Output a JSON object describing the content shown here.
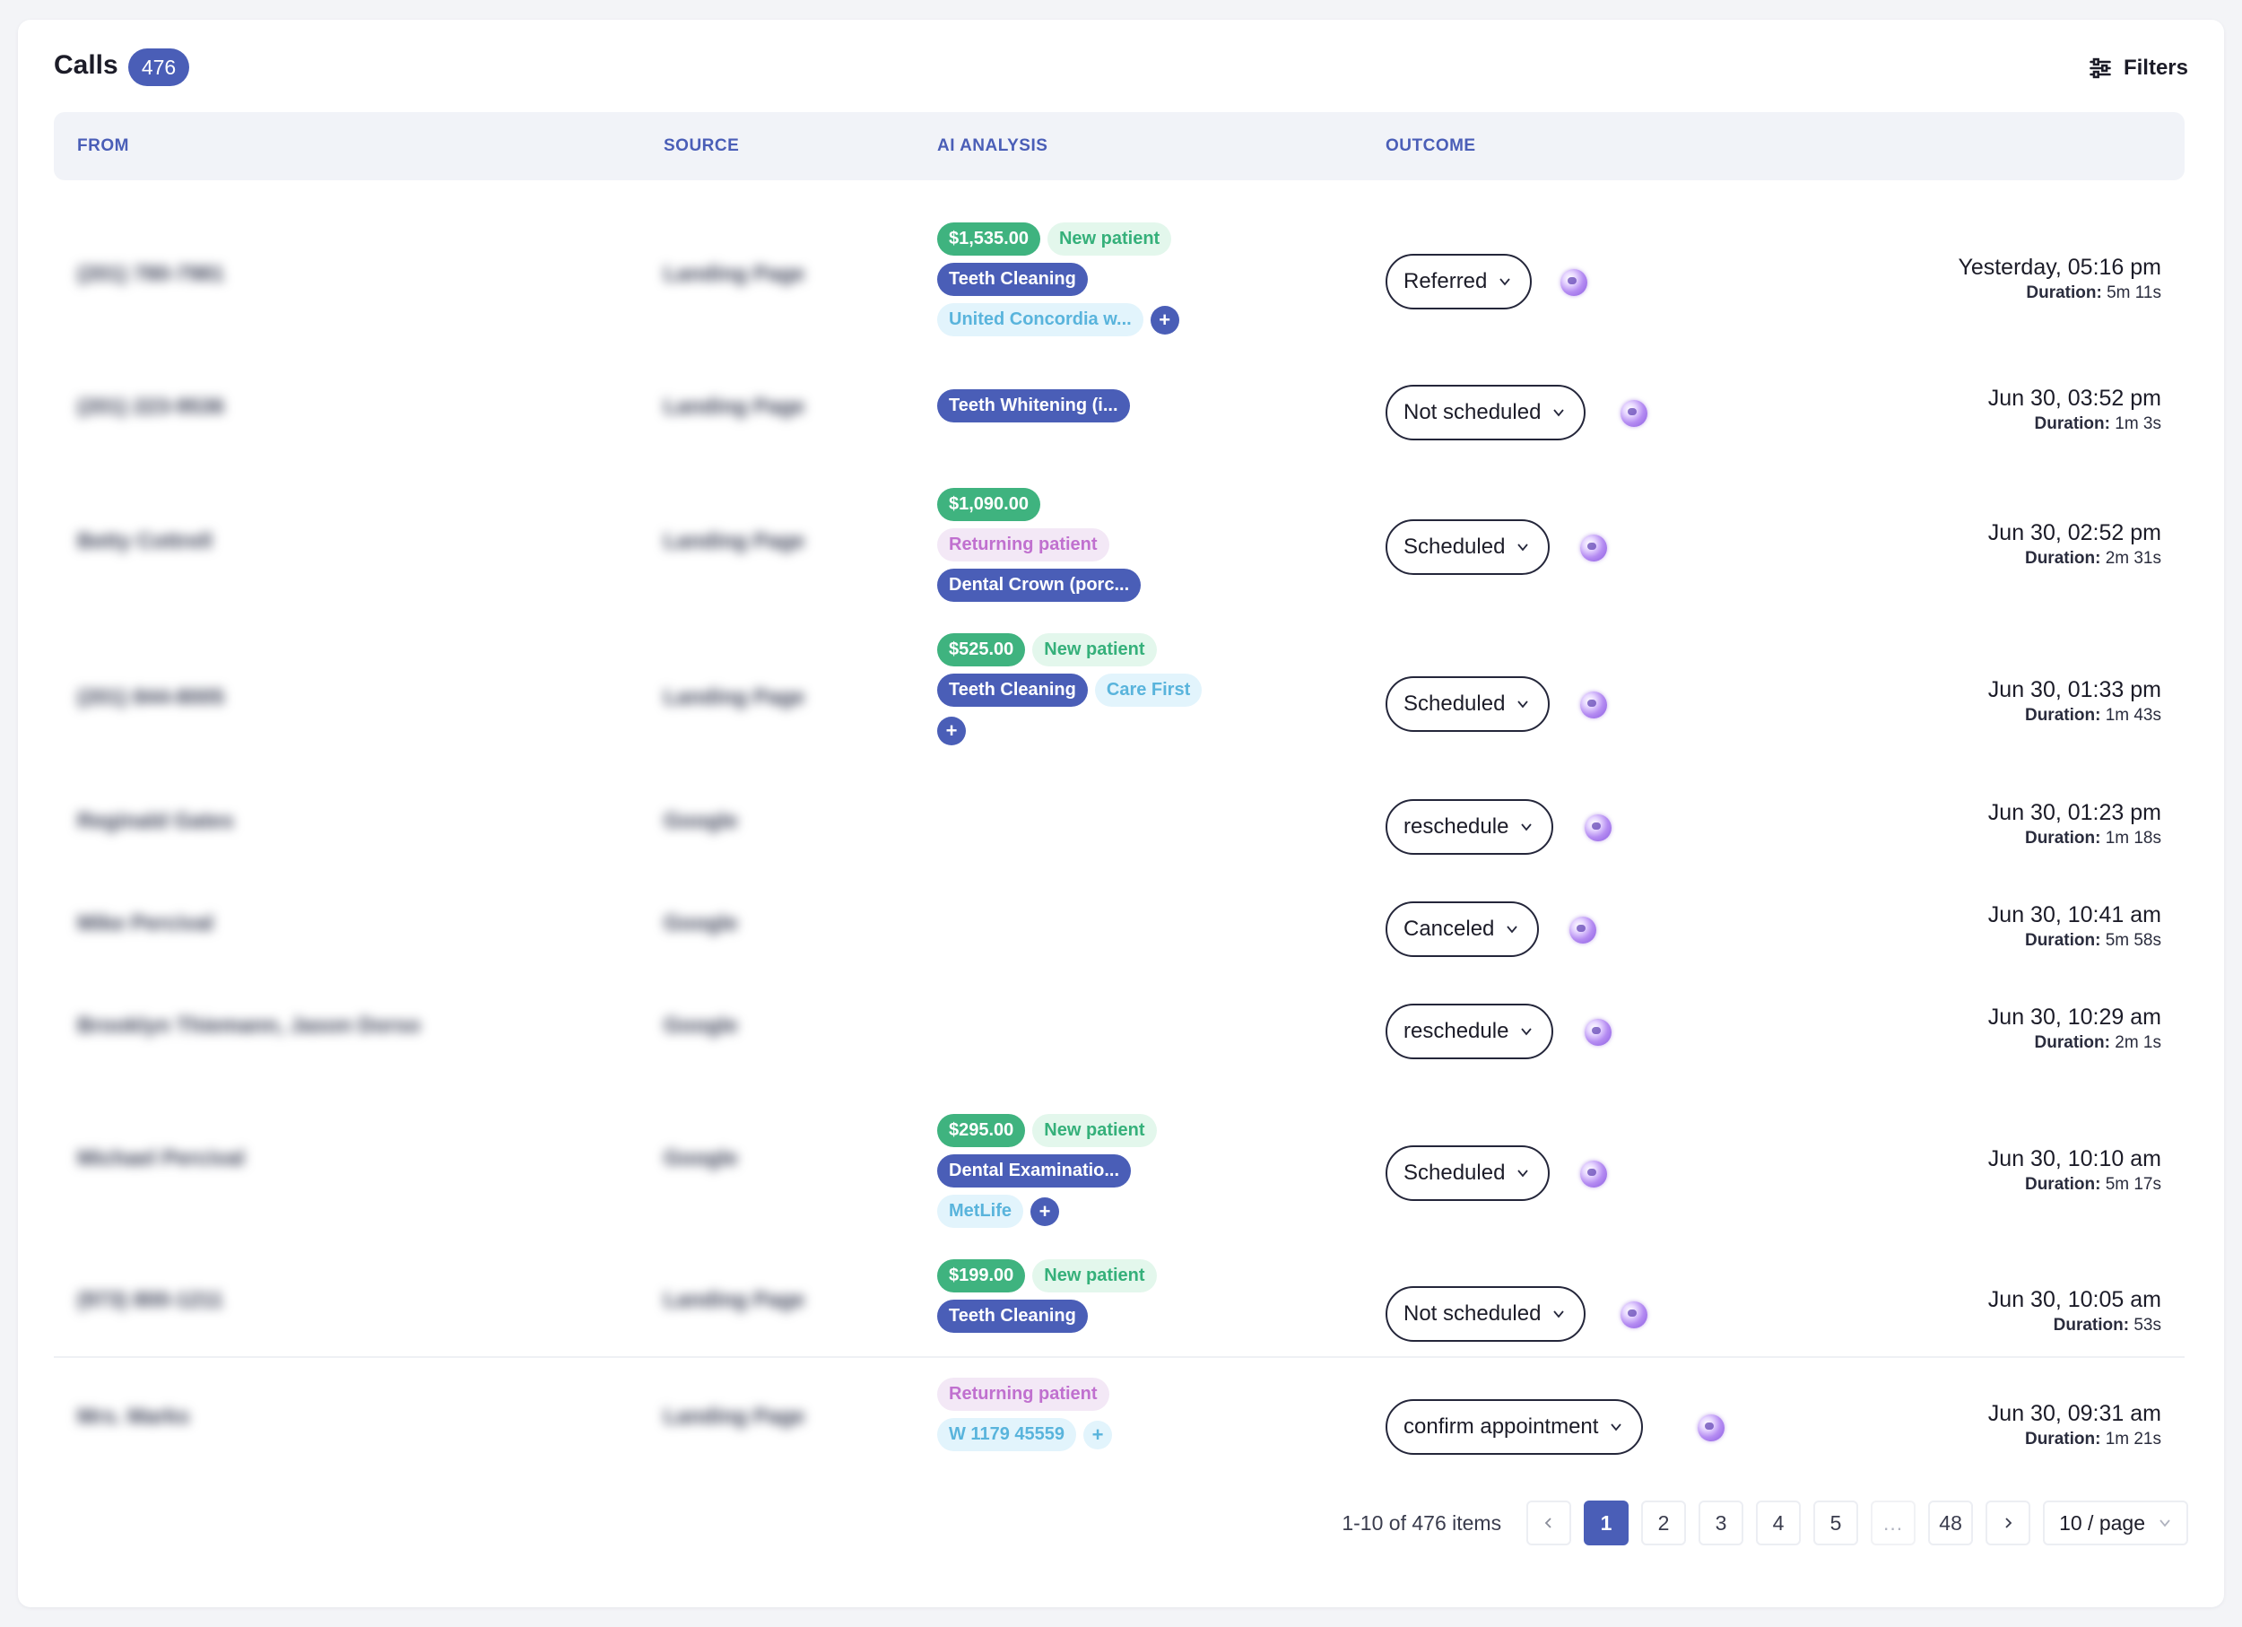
{
  "header": {
    "title": "Calls",
    "count": "476",
    "filters_label": "Filters"
  },
  "columns": {
    "from": "FROM",
    "source": "SOURCE",
    "ai_analysis": "AI ANALYSIS",
    "outcome": "OUTCOME"
  },
  "rows": [
    {
      "from": "(201) 780-7981",
      "source": "Landing Page",
      "price": "$1,535.00",
      "patient": "New patient",
      "procedure": "Teeth Cleaning",
      "insurance": "United Concordia w...",
      "plus": "+",
      "outcome": "Referred",
      "datetime": "Yesterday, 05:16 pm",
      "duration_label": "Duration:",
      "duration": "5m 11s"
    },
    {
      "from": "(201) 223-9536",
      "source": "Landing Page",
      "procedure": "Teeth Whitening (i...",
      "outcome": "Not scheduled",
      "datetime": "Jun 30, 03:52 pm",
      "duration_label": "Duration:",
      "duration": "1m 3s"
    },
    {
      "from": "Betty Cottrell",
      "source": "Landing Page",
      "price": "$1,090.00",
      "patient": "Returning patient",
      "procedure": "Dental Crown (porc...",
      "outcome": "Scheduled",
      "datetime": "Jun 30, 02:52 pm",
      "duration_label": "Duration:",
      "duration": "2m 31s"
    },
    {
      "from": "(201) 844-8005",
      "source": "Landing Page",
      "price": "$525.00",
      "patient": "New patient",
      "procedure": "Teeth Cleaning",
      "insurance": "Care First",
      "plus": "+",
      "outcome": "Scheduled",
      "datetime": "Jun 30, 01:33 pm",
      "duration_label": "Duration:",
      "duration": "1m 43s"
    },
    {
      "from": "Reginald Gates",
      "source": "Google",
      "outcome": "reschedule",
      "datetime": "Jun 30, 01:23 pm",
      "duration_label": "Duration:",
      "duration": "1m 18s"
    },
    {
      "from": "Mike Percival",
      "source": "Google",
      "outcome": "Canceled",
      "datetime": "Jun 30, 10:41 am",
      "duration_label": "Duration:",
      "duration": "5m 58s"
    },
    {
      "from": "Brooklyn Thiemann, Jason Dorso",
      "source": "Google",
      "outcome": "reschedule",
      "datetime": "Jun 30, 10:29 am",
      "duration_label": "Duration:",
      "duration": "2m 1s"
    },
    {
      "from": "Michael Percival",
      "source": "Google",
      "price": "$295.00",
      "patient": "New patient",
      "procedure": "Dental Examinatio...",
      "insurance": "MetLife",
      "plus": "+",
      "outcome": "Scheduled",
      "datetime": "Jun 30, 10:10 am",
      "duration_label": "Duration:",
      "duration": "5m 17s"
    },
    {
      "from": "(973) 800-1211",
      "source": "Landing Page",
      "price": "$199.00",
      "patient": "New patient",
      "procedure": "Teeth Cleaning",
      "outcome": "Not scheduled",
      "datetime": "Jun 30, 10:05 am",
      "duration_label": "Duration:",
      "duration": "53s"
    },
    {
      "from": "Mrs. Marks",
      "source": "Landing Page",
      "patient": "Returning patient",
      "insurance": "W 1179 45559",
      "plus": "+",
      "outcome": "confirm appointment",
      "datetime": "Jun 30, 09:31 am",
      "duration_label": "Duration:",
      "duration": "1m 21s"
    }
  ],
  "pagination": {
    "info": "1-10 of 476 items",
    "pages": [
      "1",
      "2",
      "3",
      "4",
      "5"
    ],
    "ellipsis": "...",
    "last": "48",
    "current": "1",
    "page_size": "10 / page"
  },
  "colors": {
    "accent": "#4a5eb7",
    "price": "#3fb37f",
    "new_patient": "#35b07a",
    "returning_patient": "#c070cf",
    "insurance": "#59b4dc"
  }
}
